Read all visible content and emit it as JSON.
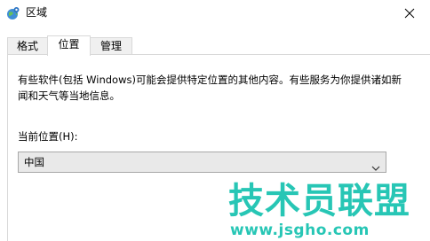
{
  "window": {
    "title": "区域",
    "icon": "globe-location-icon",
    "close_icon": "close-icon"
  },
  "tabs": [
    {
      "label": "格式",
      "active": false
    },
    {
      "label": "位置",
      "active": true
    },
    {
      "label": "管理",
      "active": false
    }
  ],
  "location": {
    "description": "有些软件(包括 Windows)可能会提供特定位置的其他内容。有些服务为你提供诸如新闻和天气等当地信息。",
    "current_label": "当前位置(H):",
    "selected": "中国"
  },
  "watermark": {
    "title": "技术员联盟",
    "url": "www.jsgho.com",
    "color": "#27c6b5"
  }
}
